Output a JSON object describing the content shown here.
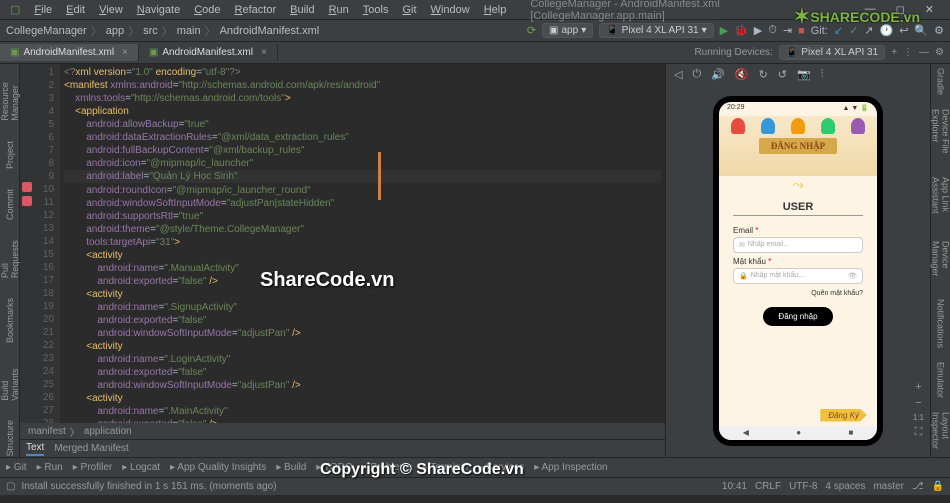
{
  "menubar": [
    "File",
    "Edit",
    "View",
    "Navigate",
    "Code",
    "Refactor",
    "Build",
    "Run",
    "Tools",
    "Git",
    "Window",
    "Help"
  ],
  "window_title": "CollegeManager - AndroidManifest.xml [CollegeManager.app.main]",
  "breadcrumb": [
    "CollegeManager",
    "app",
    "src",
    "main",
    "AndroidManifest.xml"
  ],
  "run_config": "app",
  "device_selector": "Pixel 4 XL API 31",
  "git_label": "Git:",
  "tabs": [
    {
      "label": "AndroidManifest.xml",
      "active": true
    },
    {
      "label": "AndroidManifest.xml",
      "active": false
    }
  ],
  "running_devices_label": "Running Devices:",
  "running_device": "Pixel 4 XL API 31",
  "left_tools": [
    "Resource Manager",
    "Project",
    "Commit",
    "Pull Requests",
    "Bookmarks",
    "Build Variants",
    "Structure"
  ],
  "right_tools": [
    "Gradle",
    "Device File Explorer",
    "App Link Assistant",
    "Device Manager",
    "Notifications",
    "Emulator",
    "Layout Inspector"
  ],
  "device_toolbar_icons": [
    "◁",
    "⏻",
    "🔊",
    "🔇",
    "↻",
    "↺",
    "📷",
    "⫶",
    "🔍+",
    "🔍-",
    "1:1",
    "⛶"
  ],
  "code_lines": [
    {
      "n": 1,
      "i": 0,
      "html": "<span class='cm'>&lt;?</span><span class='tag'>xml version</span>=<span class='str'>\"1.0\"</span> <span class='tag'>encoding</span>=<span class='str'>\"utf-8\"</span><span class='cm'>?&gt;</span>"
    },
    {
      "n": 2,
      "i": 0,
      "html": "<span class='tag'>&lt;manifest</span> <span class='attr'>xmlns:android</span>=<span class='str'>\"http://schemas.android.com/apk/res/android\"</span>"
    },
    {
      "n": 3,
      "i": 1,
      "html": "<span class='attr'>xmlns:tools</span>=<span class='str'>\"http://schemas.android.com/tools\"</span><span class='tag'>&gt;</span>"
    },
    {
      "n": 4,
      "i": 0,
      "html": ""
    },
    {
      "n": 5,
      "i": 1,
      "html": "<span class='tag'>&lt;application</span>"
    },
    {
      "n": 6,
      "i": 2,
      "html": "<span class='attr'>android:allowBackup</span>=<span class='str'>\"true\"</span>"
    },
    {
      "n": 7,
      "i": 2,
      "html": "<span class='attr'>android:dataExtractionRules</span>=<span class='str'>\"@xml/data_extraction_rules\"</span>"
    },
    {
      "n": 8,
      "i": 2,
      "html": "<span class='attr'>android:fullBackupContent</span>=<span class='str'>\"@xml/backup_rules\"</span>"
    },
    {
      "n": 9,
      "i": 2,
      "html": "<span class='attr'>android:icon</span>=<span class='str'>\"@mipmap/ic_launcher\"</span>"
    },
    {
      "n": 10,
      "i": 2,
      "html": "<span class='attr'>android:label</span>=<span class='str'>\"Quản Lý Học Sinh\"</span>",
      "hl": true
    },
    {
      "n": 11,
      "i": 2,
      "html": "<span class='attr'>android:roundIcon</span>=<span class='str'>\"@mipmap/ic_launcher_round\"</span>"
    },
    {
      "n": 12,
      "i": 2,
      "html": "<span class='attr'>android:windowSoftInputMode</span>=<span class='str'>\"adjustPan|stateHidden\"</span>"
    },
    {
      "n": 13,
      "i": 2,
      "html": "<span class='attr'>android:supportsRtl</span>=<span class='str'>\"true\"</span>"
    },
    {
      "n": 14,
      "i": 2,
      "html": "<span class='attr'>android:theme</span>=<span class='str'>\"@style/Theme.CollegeManager\"</span>"
    },
    {
      "n": 15,
      "i": 2,
      "html": "<span class='attr'>tools:targetApi</span>=<span class='str'>\"31\"</span><span class='tag'>&gt;</span>"
    },
    {
      "n": 16,
      "i": 2,
      "html": "<span class='tag'>&lt;activity</span>"
    },
    {
      "n": 17,
      "i": 3,
      "html": "<span class='attr'>android:name</span>=<span class='str'>\".ManualActivity\"</span>"
    },
    {
      "n": 18,
      "i": 3,
      "html": "<span class='attr'>android:exported</span>=<span class='str'>\"false\"</span> <span class='tag'>/&gt;</span>"
    },
    {
      "n": 19,
      "i": 2,
      "html": "<span class='tag'>&lt;activity</span>"
    },
    {
      "n": 20,
      "i": 3,
      "html": "<span class='attr'>android:name</span>=<span class='str'>\".SignupActivity\"</span>"
    },
    {
      "n": 21,
      "i": 3,
      "html": "<span class='attr'>android:exported</span>=<span class='str'>\"false\"</span>"
    },
    {
      "n": 22,
      "i": 3,
      "html": "<span class='attr'>android:windowSoftInputMode</span>=<span class='str'>\"adjustPan\"</span> <span class='tag'>/&gt;</span>"
    },
    {
      "n": 23,
      "i": 2,
      "html": "<span class='tag'>&lt;activity</span>"
    },
    {
      "n": 24,
      "i": 3,
      "html": "<span class='attr'>android:name</span>=<span class='str'>\".LoginActivity\"</span>"
    },
    {
      "n": 25,
      "i": 3,
      "html": "<span class='attr'>android:exported</span>=<span class='str'>\"false\"</span>"
    },
    {
      "n": 26,
      "i": 3,
      "html": "<span class='attr'>android:windowSoftInputMode</span>=<span class='str'>\"adjustPan\"</span> <span class='tag'>/&gt;</span>"
    },
    {
      "n": 27,
      "i": 2,
      "html": "<span class='tag'>&lt;activity</span>"
    },
    {
      "n": 28,
      "i": 3,
      "html": "<span class='attr'>android:name</span>=<span class='str'>\".MainActivity\"</span>"
    },
    {
      "n": 29,
      "i": 3,
      "html": "<span class='attr'>android:exported</span>=<span class='str'>\"false\"</span> <span class='tag'>/&gt;</span>"
    }
  ],
  "crumb_path": [
    "manifest",
    "application"
  ],
  "editor_tabs": [
    "Text",
    "Merged Manifest"
  ],
  "bottom_tools": [
    "Git",
    "Run",
    "Profiler",
    "Logcat",
    "App Quality Insights",
    "Build",
    "TODO",
    "Problems",
    "Terminal",
    "Services",
    "App Inspection"
  ],
  "status_msg": "Install successfully finished in 1 s 151 ms. (moments ago)",
  "status_right": [
    "10:41",
    "CRLF",
    "UTF-8",
    "4 spaces",
    "master"
  ],
  "phone": {
    "time": "20:29",
    "banner": "ĐĂNG NHẬP",
    "user": "USER",
    "email_label": "Email",
    "email_ph": "Nhập email...",
    "pass_label": "Mật khẩu",
    "pass_ph": "Nhập mật khẩu...",
    "forgot": "Quên mật khẩu?",
    "login": "Đăng nhập",
    "signup": "Đăng Ký"
  },
  "watermarks": {
    "center": "ShareCode.vn",
    "bottom": "Copyright © ShareCode.vn",
    "logo": "SHARECODE.vn"
  }
}
